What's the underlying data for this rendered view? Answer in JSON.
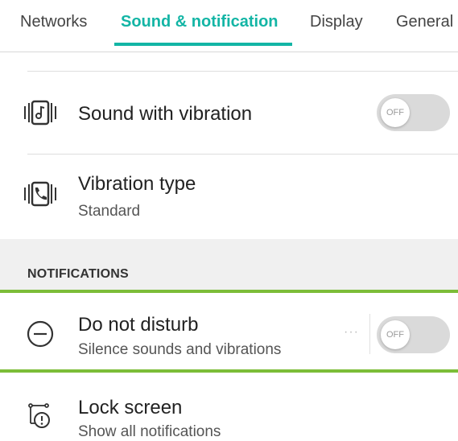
{
  "tabs": [
    {
      "label": "Networks",
      "active": false
    },
    {
      "label": "Sound & notification",
      "active": true
    },
    {
      "label": "Display",
      "active": false
    },
    {
      "label": "General",
      "active": false
    }
  ],
  "rows": {
    "sound_with_vibration": {
      "title": "Sound with vibration",
      "toggle": "OFF",
      "icon": "vibrate-music-icon"
    },
    "vibration_type": {
      "title": "Vibration type",
      "subtitle": "Standard",
      "icon": "vibrate-phone-icon"
    }
  },
  "section": {
    "notifications_title": "NOTIFICATIONS"
  },
  "notif_rows": {
    "do_not_disturb": {
      "title": "Do not disturb",
      "subtitle": "Silence sounds and vibrations",
      "toggle": "OFF",
      "more": "···",
      "icon": "minus-circle-icon"
    },
    "lock_screen": {
      "title": "Lock screen",
      "subtitle": "Show all notifications",
      "icon": "lock-notification-icon"
    }
  },
  "colors": {
    "accent": "#13b5a5",
    "highlight": "#7cbd38",
    "toggle_off": "#dadada"
  }
}
